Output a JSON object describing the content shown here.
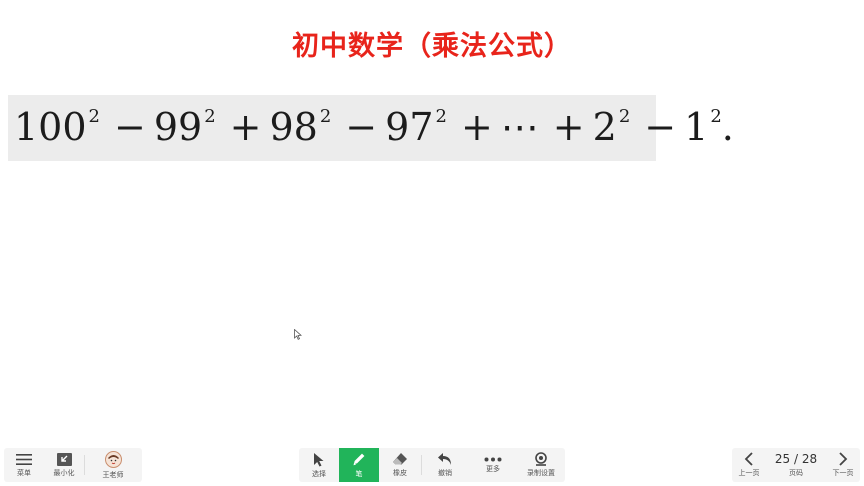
{
  "slide": {
    "title": "初中数学（乘法公式）",
    "formula": {
      "terms": [
        {
          "op": "",
          "base": "100",
          "exp": "2"
        },
        {
          "op": "−",
          "base": "99",
          "exp": "2"
        },
        {
          "op": "+",
          "base": "98",
          "exp": "2"
        },
        {
          "op": "−",
          "base": "97",
          "exp": "2"
        },
        {
          "op": "+",
          "base": "⋯",
          "exp": ""
        },
        {
          "op": "+",
          "base": "2",
          "exp": "2"
        },
        {
          "op": "−",
          "base": "1",
          "exp": "2"
        }
      ],
      "end": "."
    }
  },
  "toolbar_left": {
    "menu_label": "菜单",
    "minimize_label": "最小化",
    "user_label": "王老师"
  },
  "toolbar_mid": {
    "select_label": "选择",
    "pen_label": "笔",
    "eraser_label": "橡皮",
    "undo_label": "撤销",
    "more_label": "更多",
    "record_label": "录制设置"
  },
  "toolbar_right": {
    "prev_label": "上一页",
    "page_label": "页码",
    "page_text": "25 / 28",
    "next_label": "下一页"
  },
  "colors": {
    "title": "#e8241b",
    "pen_active": "#21b45a",
    "toolbar_bg": "#f4f4f4"
  }
}
